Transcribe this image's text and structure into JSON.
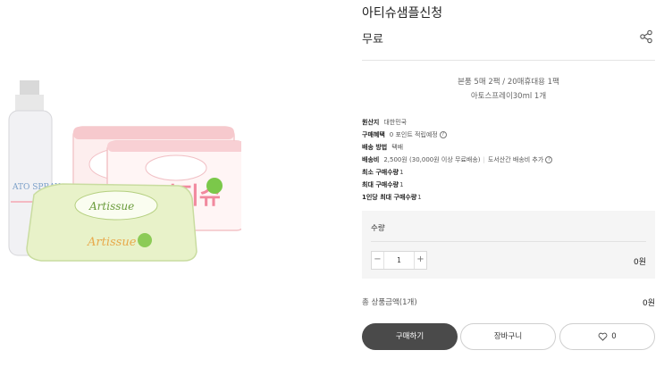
{
  "product": {
    "title": "아티슈샘플신청",
    "price": "무료",
    "images": {
      "spray_label": "ATO SPRAY",
      "brand_text": "Artissue"
    }
  },
  "description": {
    "line1": "본품 5매 2팩 / 20매휴대용 1팩",
    "line2": "아토스프레이30ml 1개"
  },
  "info": {
    "origin_label": "원산지",
    "origin_value": "대한민국",
    "benefit_label": "구매혜택",
    "benefit_value": "0 포인트 적립예정",
    "ship_method_label": "배송 방법",
    "ship_method_value": "택배",
    "ship_fee_label": "배송비",
    "ship_fee_value": "2,500원 (30,000원 이상 무료배송)",
    "ship_extra": "도서산간 배송비 추가",
    "min_qty_label": "최소 구매수량",
    "min_qty_value": "1",
    "max_qty_label": "최대 구매수량",
    "max_qty_value": "1",
    "per_person_label": "1인당 최대 구매수량",
    "per_person_value": "1"
  },
  "quantity": {
    "label": "수량",
    "minus": "−",
    "value": "1",
    "plus": "+",
    "line_price": "0원"
  },
  "total": {
    "label": "총 상품금액(1개)",
    "value": "0원"
  },
  "buttons": {
    "buy": "구매하기",
    "cart": "장바구니",
    "wish_count": "0"
  }
}
